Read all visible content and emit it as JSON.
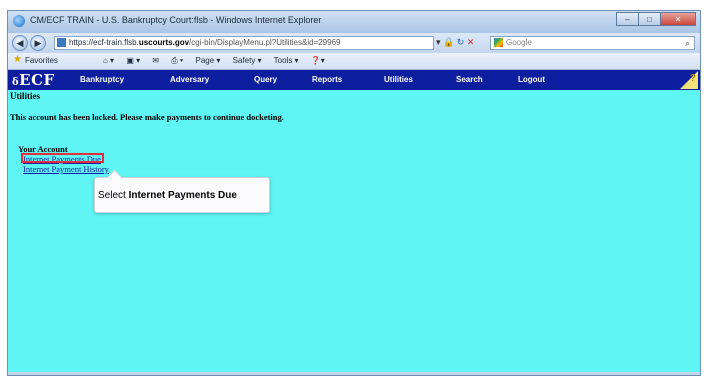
{
  "window": {
    "title": "CM/ECF TRAIN - U.S. Bankruptcy Court:flsb - Windows Internet Explorer",
    "controls": [
      "–",
      "□",
      "✕"
    ]
  },
  "addressbar": {
    "url_prefix": "https://ecf-train.flsb.",
    "url_domain": "uscourts.gov",
    "url_suffix": "/cgi-bin/DisplayMenu.pl?Utilities&id=29969",
    "search_placeholder": "Google"
  },
  "favorites_bar": {
    "favorites_label": "Favorites",
    "commands": [
      "Page ▾",
      "Safety ▾",
      "Tools ▾"
    ]
  },
  "ecf_menu": {
    "logo": "ECF",
    "items": [
      "Bankruptcy",
      "Adversary",
      "Query",
      "Reports",
      "Utilities",
      "Search",
      "Logout"
    ]
  },
  "page": {
    "title": "Utilities",
    "lock_message": "This account has been locked. Please make payments to continue docketing.",
    "account_heading": "Your Account",
    "links": [
      "Internet Payments Due",
      "Internet Payment History"
    ]
  },
  "callout": {
    "prefix": "Select ",
    "target": "Internet Payments Due"
  }
}
